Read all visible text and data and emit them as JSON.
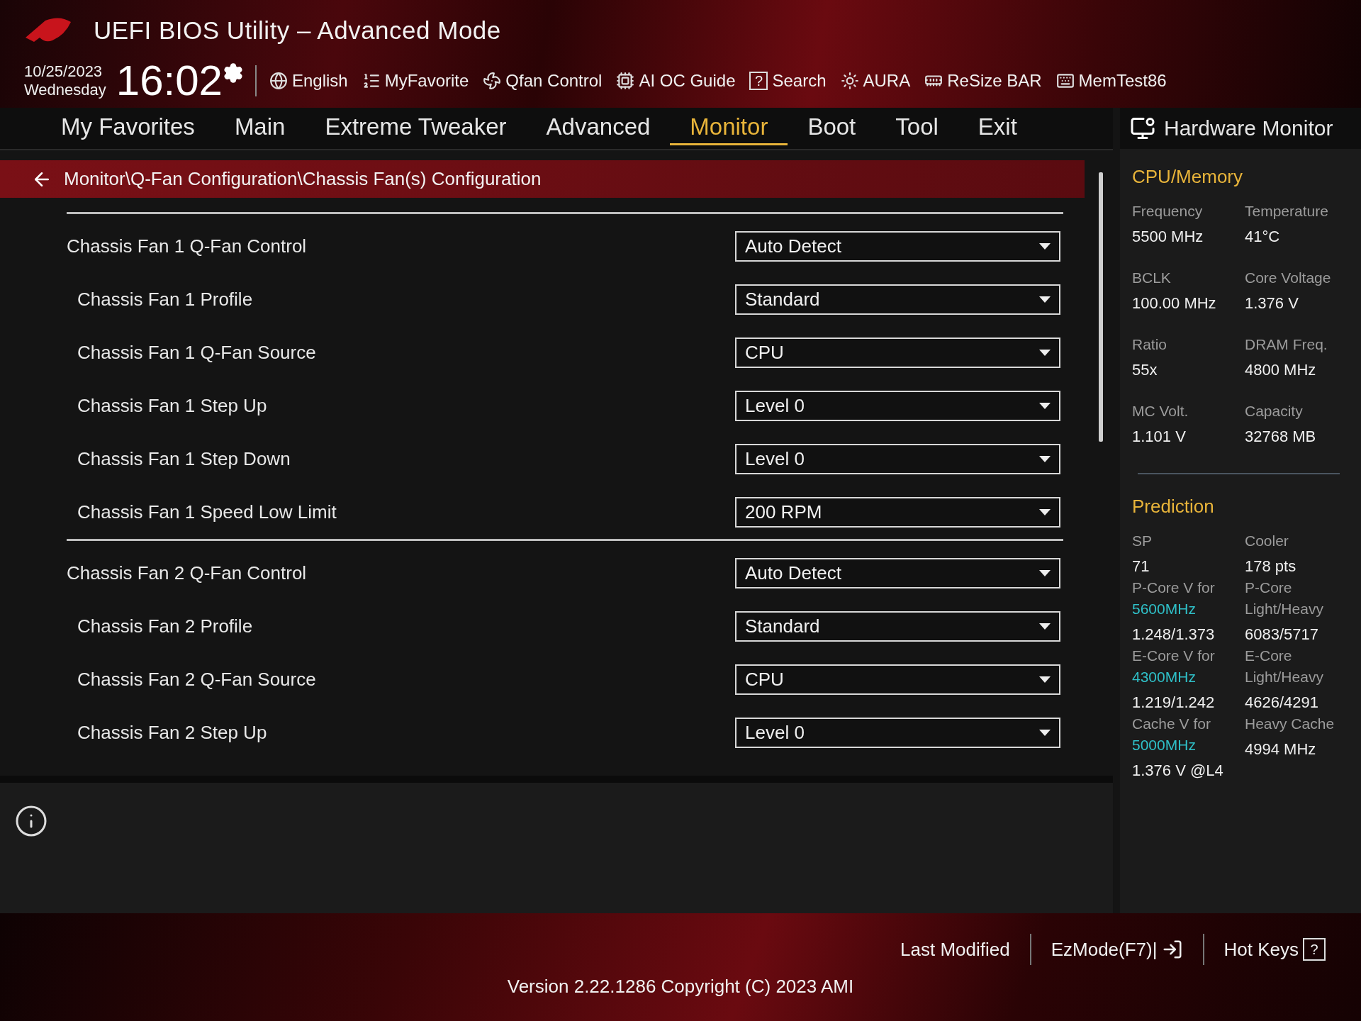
{
  "header": {
    "title": "UEFI BIOS Utility – Advanced Mode",
    "date": "10/25/2023",
    "day": "Wednesday",
    "time": "16:02",
    "toolbar": [
      {
        "label": "English",
        "kind": "globe"
      },
      {
        "label": "MyFavorite",
        "kind": "list"
      },
      {
        "label": "Qfan Control",
        "kind": "fan"
      },
      {
        "label": "AI OC Guide",
        "kind": "chip"
      },
      {
        "label": "Search",
        "kind": "search",
        "glyph": "?"
      },
      {
        "label": "AURA",
        "kind": "light"
      },
      {
        "label": "ReSize BAR",
        "kind": "card"
      },
      {
        "label": "MemTest86",
        "kind": "memory"
      }
    ]
  },
  "tabs": [
    {
      "label": "My Favorites",
      "selected": false
    },
    {
      "label": "Main",
      "selected": false
    },
    {
      "label": "Extreme Tweaker",
      "selected": false
    },
    {
      "label": "Advanced",
      "selected": false
    },
    {
      "label": "Monitor",
      "selected": true
    },
    {
      "label": "Boot",
      "selected": false
    },
    {
      "label": "Tool",
      "selected": false
    },
    {
      "label": "Exit",
      "selected": false
    }
  ],
  "breadcrumb": "Monitor\\Q-Fan Configuration\\Chassis Fan(s) Configuration",
  "settings": [
    {
      "items": [
        {
          "label": "Chassis Fan 1 Q-Fan Control",
          "value": "Auto Detect",
          "kind": "main"
        },
        {
          "label": "Chassis Fan 1 Profile",
          "value": "Standard",
          "kind": "sub"
        },
        {
          "label": "Chassis Fan 1 Q-Fan Source",
          "value": "CPU",
          "kind": "sub"
        },
        {
          "label": "Chassis Fan 1 Step Up",
          "value": "Level 0",
          "kind": "sub"
        },
        {
          "label": "Chassis Fan 1 Step Down",
          "value": "Level 0",
          "kind": "sub"
        },
        {
          "label": "Chassis Fan 1 Speed Low Limit",
          "value": "200 RPM",
          "kind": "sub"
        }
      ]
    },
    {
      "items": [
        {
          "label": "Chassis Fan 2 Q-Fan Control",
          "value": "Auto Detect",
          "kind": "main"
        },
        {
          "label": "Chassis Fan 2 Profile",
          "value": "Standard",
          "kind": "sub"
        },
        {
          "label": "Chassis Fan 2 Q-Fan Source",
          "value": "CPU",
          "kind": "sub"
        },
        {
          "label": "Chassis Fan 2 Step Up",
          "value": "Level 0",
          "kind": "sub"
        }
      ]
    }
  ],
  "hardware_monitor": {
    "title": "Hardware Monitor",
    "sections": [
      {
        "title": "CPU/Memory",
        "items": [
          {
            "label": [
              "Frequency"
            ],
            "value": "5500 MHz"
          },
          {
            "label": [
              "Temperature"
            ],
            "value": "41°C"
          },
          {
            "label": [
              "BCLK"
            ],
            "value": "100.00 MHz"
          },
          {
            "label": [
              "Core Voltage"
            ],
            "value": "1.376 V"
          },
          {
            "label": [
              "Ratio"
            ],
            "value": "55x"
          },
          {
            "label": [
              "DRAM Freq."
            ],
            "value": "4800 MHz"
          },
          {
            "label": [
              "MC Volt."
            ],
            "value": "1.101 V"
          },
          {
            "label": [
              "Capacity"
            ],
            "value": "32768 MB"
          }
        ]
      },
      {
        "title": "Prediction",
        "items": [
          {
            "label": [
              "SP"
            ],
            "value": "71"
          },
          {
            "label": [
              "Cooler"
            ],
            "value": "178 pts"
          },
          {
            "label": [
              "P-Core V for"
            ],
            "accent": "5600MHz",
            "value": "1.248/1.373"
          },
          {
            "label": [
              "P-Core",
              "Light/Heavy"
            ],
            "value": "6083/5717"
          },
          {
            "label": [
              "E-Core V for"
            ],
            "accent": "4300MHz",
            "value": "1.219/1.242"
          },
          {
            "label": [
              "E-Core",
              "Light/Heavy"
            ],
            "value": "4626/4291"
          },
          {
            "label": [
              "Cache V for"
            ],
            "accent": "5000MHz",
            "value": "1.376 V @L4"
          },
          {
            "label": [
              "Heavy Cache"
            ],
            "value": "4994 MHz"
          }
        ]
      }
    ]
  },
  "footer": {
    "last_modified": "Last Modified",
    "ezmode": "EzMode(F7)|",
    "hot_keys": "Hot Keys",
    "hot_keys_glyph": "?",
    "version": "Version 2.22.1286 Copyright (C) 2023 AMI"
  }
}
